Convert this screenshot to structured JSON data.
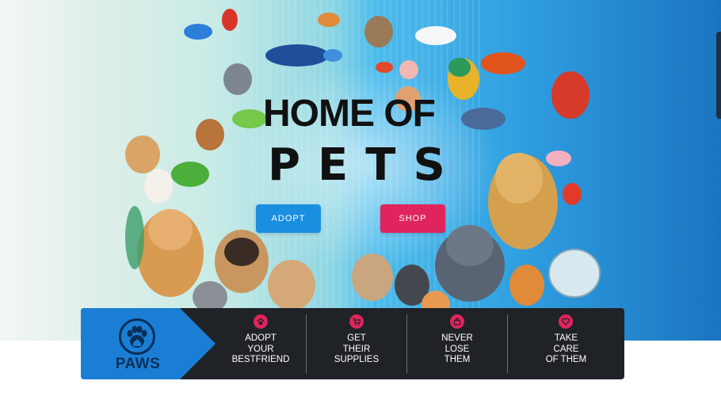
{
  "hero": {
    "title_line1": "HOME OF",
    "title_line2": "PETS",
    "adopt_button": "ADOPT",
    "shop_button": "SHOP"
  },
  "feature_bar": {
    "logo_text": "PAWS",
    "logo_icon": "paw-house-icon",
    "items": [
      {
        "icon": "paw-icon",
        "label": "ADOPT\nYOUR\nBESTFRIEND"
      },
      {
        "icon": "cart-icon",
        "label": "GET\nTHEIR\nSUPPLIES"
      },
      {
        "icon": "bag-icon",
        "label": "NEVER\nLOSE\nTHEM"
      },
      {
        "icon": "heart-icon",
        "label": "TAKE\nCARE\nOF THEM"
      }
    ]
  },
  "colors": {
    "accent_blue": "#1a8fe0",
    "accent_pink": "#e0245e",
    "bar_dark": "#1f2227",
    "logo_navy": "#0b2f5a"
  }
}
